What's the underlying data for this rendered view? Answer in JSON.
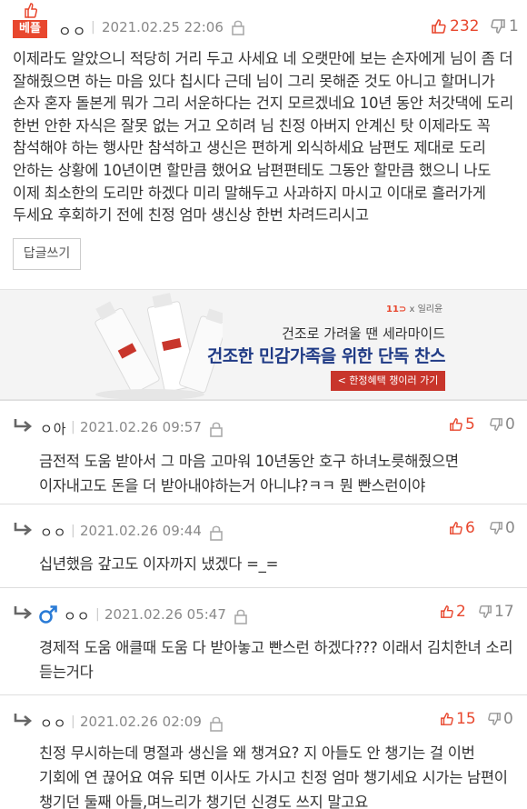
{
  "best": {
    "badge": "베플",
    "nick": "ㅇㅇ",
    "date": "2021.02.25 22:06",
    "up": "232",
    "down": "1",
    "text": "이제라도 알았으니 적당히 거리 두고 사세요 네 오랫만에 보는 손자에게 님이 좀 더 잘해줬으면 하는 마음 있다 칩시다 근데 님이 그리 못해준 것도 아니고 할머니가 손자 혼자 돌본게 뭐가 그리 서운하다는 건지 모르겠네요 10년 동안 처갓댁에 도리 한번 안한 자식은 잘못 없는 거고 오히려 님 친정 아버지 안계신 탓 이제라도 꼭 참석해야 하는 행사만 참석하고 생신은 편하게 외식하세요 남편도 제대로 도리 안하는 상황에 10년이면 할만큼 했어요 남편편테도 그동안 할만큼 했으니 나도 이제 최소한의 도리만 하겠다 미리 말해두고 사과하지 마시고 이대로 흘러가게 두세요 후회하기 전에 친정 엄마 생신상 한번 차려드리시고",
    "reply_label": "답글쓰기"
  },
  "ad": {
    "brand_logo": "11",
    "brand_partner": "x 일리윤",
    "line1_a": "건조로 가려울 땐 ",
    "line1_b": "세라마이드",
    "line2": "건조한 민감가족을 위한 단독 찬스",
    "cta": "< 한정혜택 챙이러 가기"
  },
  "comments": [
    {
      "nick": "ㅇ아",
      "date": "2021.02.26 09:57",
      "up": "5",
      "down": "0",
      "gender": "",
      "text": "금전적 도움 받아서 그 마음 고마워 10년동안 호구 하녀노릇해줬으면 이자내고도 돈을 더 받아내야하는거 아니냐?ㅋㅋ 뭔 빤스런이야"
    },
    {
      "nick": "ㅇㅇ",
      "date": "2021.02.26 09:44",
      "up": "6",
      "down": "0",
      "gender": "",
      "text": "십년했음 갚고도 이자까지 냈겠다 =_="
    },
    {
      "nick": "ㅇㅇ",
      "date": "2021.02.26 05:47",
      "up": "2",
      "down": "17",
      "gender": "male",
      "text": "경제적 도움 애클때 도움 다 받아놓고 빤스런 하겠다??? 이래서 김치한녀 소리 듣는거다"
    },
    {
      "nick": "ㅇㅇ",
      "date": "2021.02.26 02:09",
      "up": "15",
      "down": "0",
      "gender": "",
      "text": "친정 무시하는데 명절과 생신을 왜 챙겨요? 지 아들도 안 챙기는 걸 이번 기회에 연 끊어요 여유 되면 이사도 가시고 친정 엄마 챙기세요 시가는 남편이 챙기던 둘째 아들,며느리가 챙기던 신경도 쓰지 말고요"
    }
  ],
  "colors": {
    "accent": "#e8472e",
    "ad_blue": "#1f3a85",
    "ad_red": "#c8352b",
    "male": "#2a7bd6"
  }
}
